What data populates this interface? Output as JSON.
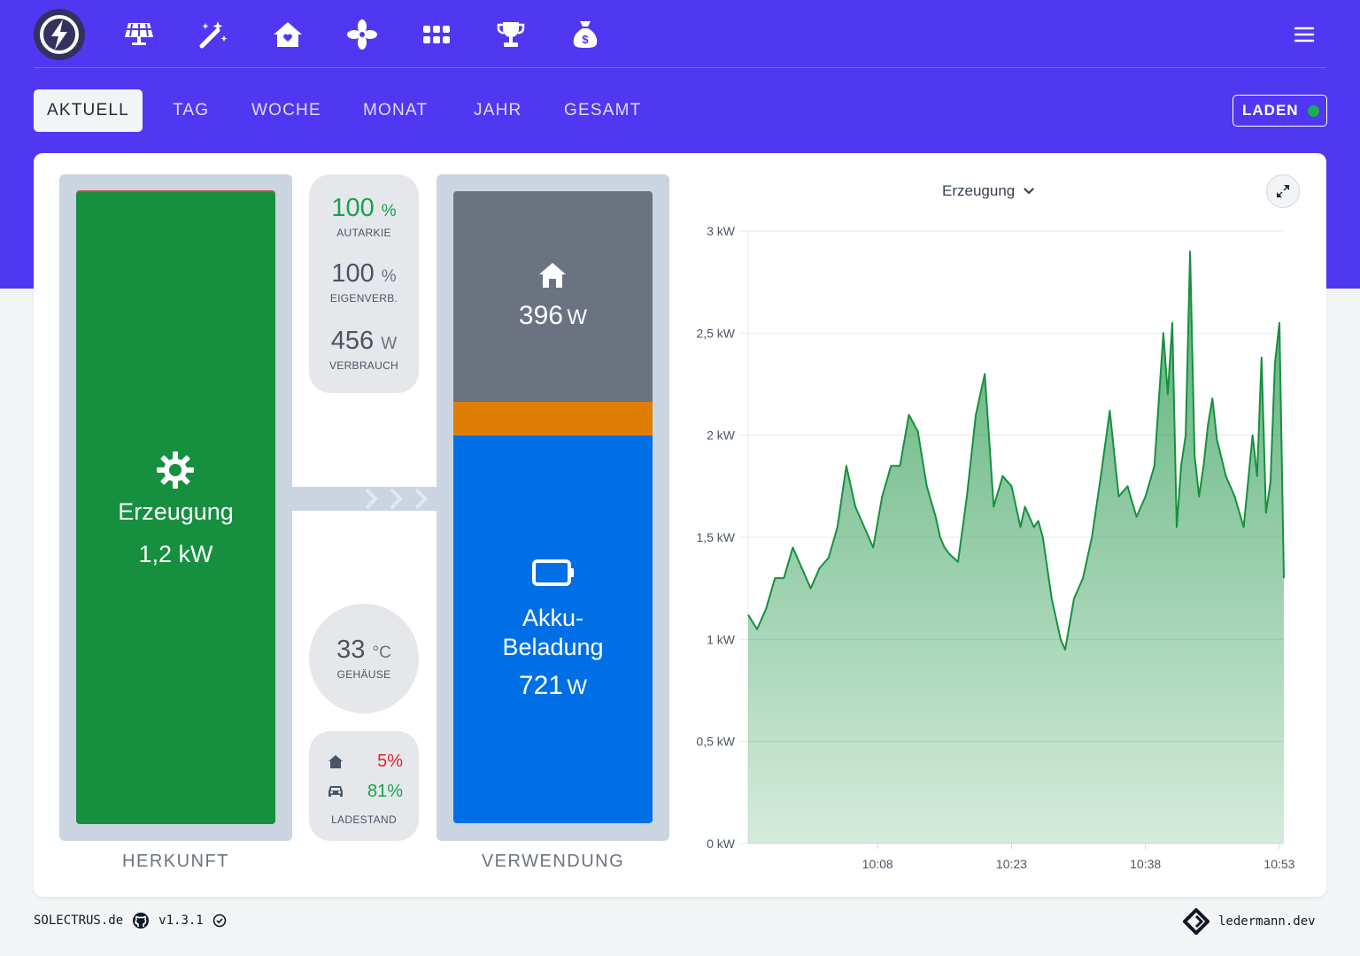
{
  "nav": {
    "icons": [
      "logo-bolt-icon",
      "solar-panel-icon",
      "magic-wand-icon",
      "house-icon",
      "fan-icon",
      "grid-icon",
      "trophy-icon",
      "money-bag-icon",
      "hamburger-menu-icon"
    ]
  },
  "tabs": [
    "AKTUELL",
    "TAG",
    "WOCHE",
    "MONAT",
    "JAHR",
    "GESAMT"
  ],
  "active_tab": "AKTUELL",
  "laden": {
    "label": "LADEN",
    "status_color": "#18b04c"
  },
  "herkunft": {
    "label": "Erzeugung",
    "value": "1,2",
    "unit": "kW",
    "caption": "HERKUNFT",
    "color": "#16903f"
  },
  "stats": {
    "autarkie": {
      "value": "100",
      "unit": "%",
      "label": "AUTARKIE"
    },
    "eigenverbrauch": {
      "value": "100",
      "unit": "%",
      "label": "EIGENVERB."
    },
    "verbrauch": {
      "value": "456",
      "unit": "W",
      "label": "VERBRAUCH"
    },
    "temperatur": {
      "value": "33",
      "unit": "°C",
      "label": "GEHÄUSE"
    },
    "ladestand": {
      "house": "5%",
      "car": "81%",
      "label": "LADESTAND"
    }
  },
  "verwendung": {
    "caption": "VERWENDUNG",
    "haus": {
      "value": "396",
      "unit": "W",
      "color": "#6b7280"
    },
    "akku": {
      "label_line1": "Akku-",
      "label_line2": "Beladung",
      "value": "721",
      "unit": "W",
      "color": "#006fe6"
    },
    "other_color": "#df7d05"
  },
  "chart_selector": "Erzeugung",
  "chart_data": {
    "type": "area",
    "y_ticks": [
      "0 kW",
      "0,5 kW",
      "1 kW",
      "1,5 kW",
      "2 kW",
      "2,5 kW",
      "3 kW"
    ],
    "x_ticks": [
      "10:08",
      "10:23",
      "10:38",
      "10:53"
    ],
    "ylim": [
      0,
      3
    ],
    "xlim": [
      -14.5,
      45.5
    ],
    "x_unit": "minutes relative to 10:08",
    "series": [
      {
        "color": "#16903f",
        "x": [
          -14.5,
          -13.5,
          -12.5,
          -11.5,
          -10.5,
          -9.5,
          -8.5,
          -7.5,
          -6.5,
          -5.5,
          -4.5,
          -3.5,
          -2.5,
          -1.5,
          -0.5,
          0.5,
          1.5,
          2.5,
          3.5,
          4.5,
          5.5,
          6.5,
          7,
          7.5,
          8,
          8.5,
          9,
          10,
          11,
          12,
          13,
          14,
          15,
          16,
          16.5,
          17,
          17.5,
          18,
          18.5,
          19,
          19.5,
          20,
          20.5,
          21,
          22,
          23,
          24,
          25,
          26,
          27,
          28,
          29,
          30,
          31,
          32,
          32.5,
          33,
          33.5,
          34,
          34.5,
          35,
          35.5,
          36,
          36.5,
          37,
          37.5,
          38,
          39,
          40,
          41,
          42,
          42.5,
          43,
          43.5,
          44,
          44.5,
          45,
          45.5
        ],
        "y": [
          1.12,
          1.05,
          1.15,
          1.3,
          1.3,
          1.45,
          1.35,
          1.25,
          1.35,
          1.4,
          1.55,
          1.85,
          1.65,
          1.55,
          1.45,
          1.7,
          1.85,
          1.85,
          2.1,
          2.02,
          1.75,
          1.6,
          1.5,
          1.45,
          1.42,
          1.4,
          1.38,
          1.7,
          2.1,
          2.3,
          1.65,
          1.8,
          1.75,
          1.55,
          1.65,
          1.6,
          1.55,
          1.58,
          1.5,
          1.35,
          1.2,
          1.1,
          1.0,
          0.95,
          1.2,
          1.3,
          1.5,
          1.8,
          2.12,
          1.7,
          1.75,
          1.6,
          1.7,
          1.85,
          2.5,
          2.2,
          2.55,
          1.55,
          1.85,
          2.0,
          2.9,
          1.9,
          1.7,
          1.85,
          2.05,
          2.18,
          1.98,
          1.8,
          1.7,
          1.55,
          2.0,
          1.8,
          2.38,
          1.62,
          1.77,
          2.35,
          2.55,
          1.3
        ]
      }
    ]
  }
}
